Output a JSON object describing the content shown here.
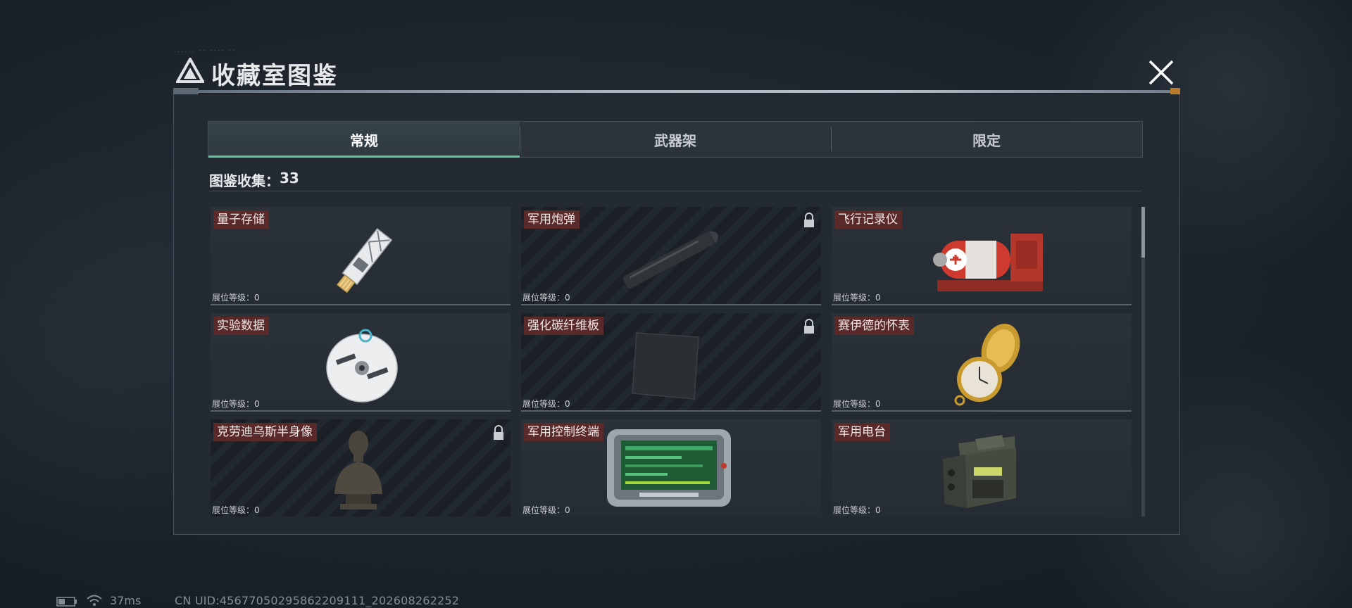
{
  "header": {
    "title": "收藏室图鉴",
    "tiny_text": "...... ·· ···· ··"
  },
  "tabs": [
    {
      "label": "常规",
      "active": true
    },
    {
      "label": "武器架",
      "active": false
    },
    {
      "label": "限定",
      "active": false
    }
  ],
  "collection": {
    "label": "图鉴收集：",
    "count": "33"
  },
  "items": [
    {
      "name": "量子存储",
      "level_label": "展位等级：",
      "level": "0",
      "locked": false,
      "icon": "usb-drive-icon"
    },
    {
      "name": "军用炮弹",
      "level_label": "展位等级：",
      "level": "0",
      "locked": true,
      "icon": "artillery-shell-icon"
    },
    {
      "name": "飞行记录仪",
      "level_label": "展位等级：",
      "level": "0",
      "locked": false,
      "icon": "flight-recorder-icon"
    },
    {
      "name": "实验数据",
      "level_label": "展位等级：",
      "level": "0",
      "locked": false,
      "icon": "disc-icon"
    },
    {
      "name": "强化碳纤维板",
      "level_label": "展位等级：",
      "level": "0",
      "locked": true,
      "icon": "carbon-plate-icon"
    },
    {
      "name": "赛伊德的怀表",
      "level_label": "展位等级：",
      "level": "0",
      "locked": false,
      "icon": "pocket-watch-icon"
    },
    {
      "name": "克劳迪乌斯半身像",
      "level_label": "展位等级：",
      "level": "0",
      "locked": true,
      "icon": "bust-statue-icon"
    },
    {
      "name": "军用控制终端",
      "level_label": "展位等级：",
      "level": "0",
      "locked": false,
      "icon": "control-terminal-icon"
    },
    {
      "name": "军用电台",
      "level_label": "展位等级：",
      "level": "0",
      "locked": false,
      "icon": "military-radio-icon"
    }
  ],
  "status": {
    "ping": "37ms",
    "uid": "CN UID:4567705029586220911​1_202608262252"
  },
  "colors": {
    "accent": "#5fc8a0",
    "name_tag": "#5a2a2a",
    "panel": "#242a32"
  },
  "scroll_position": 0
}
